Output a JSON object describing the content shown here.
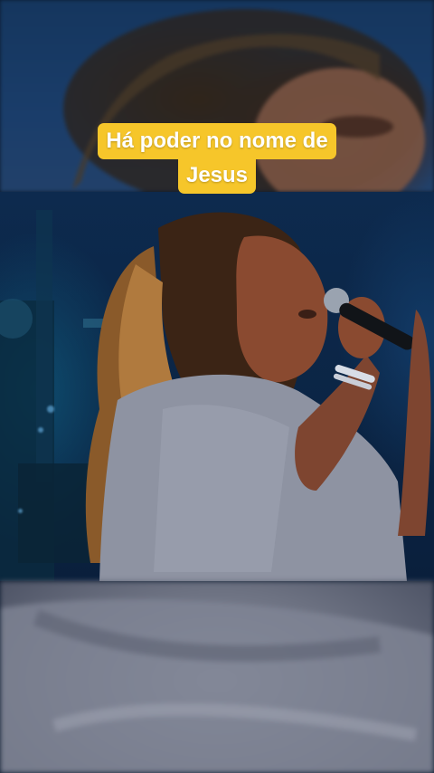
{
  "video": {
    "caption_lines": [
      "Há poder no nome de",
      "Jesus"
    ]
  },
  "colors": {
    "caption_background": "#f6c62a",
    "caption_text": "#ffffff",
    "stage_blue": "#0b2545",
    "shirt_grey": "#8e93a2"
  }
}
